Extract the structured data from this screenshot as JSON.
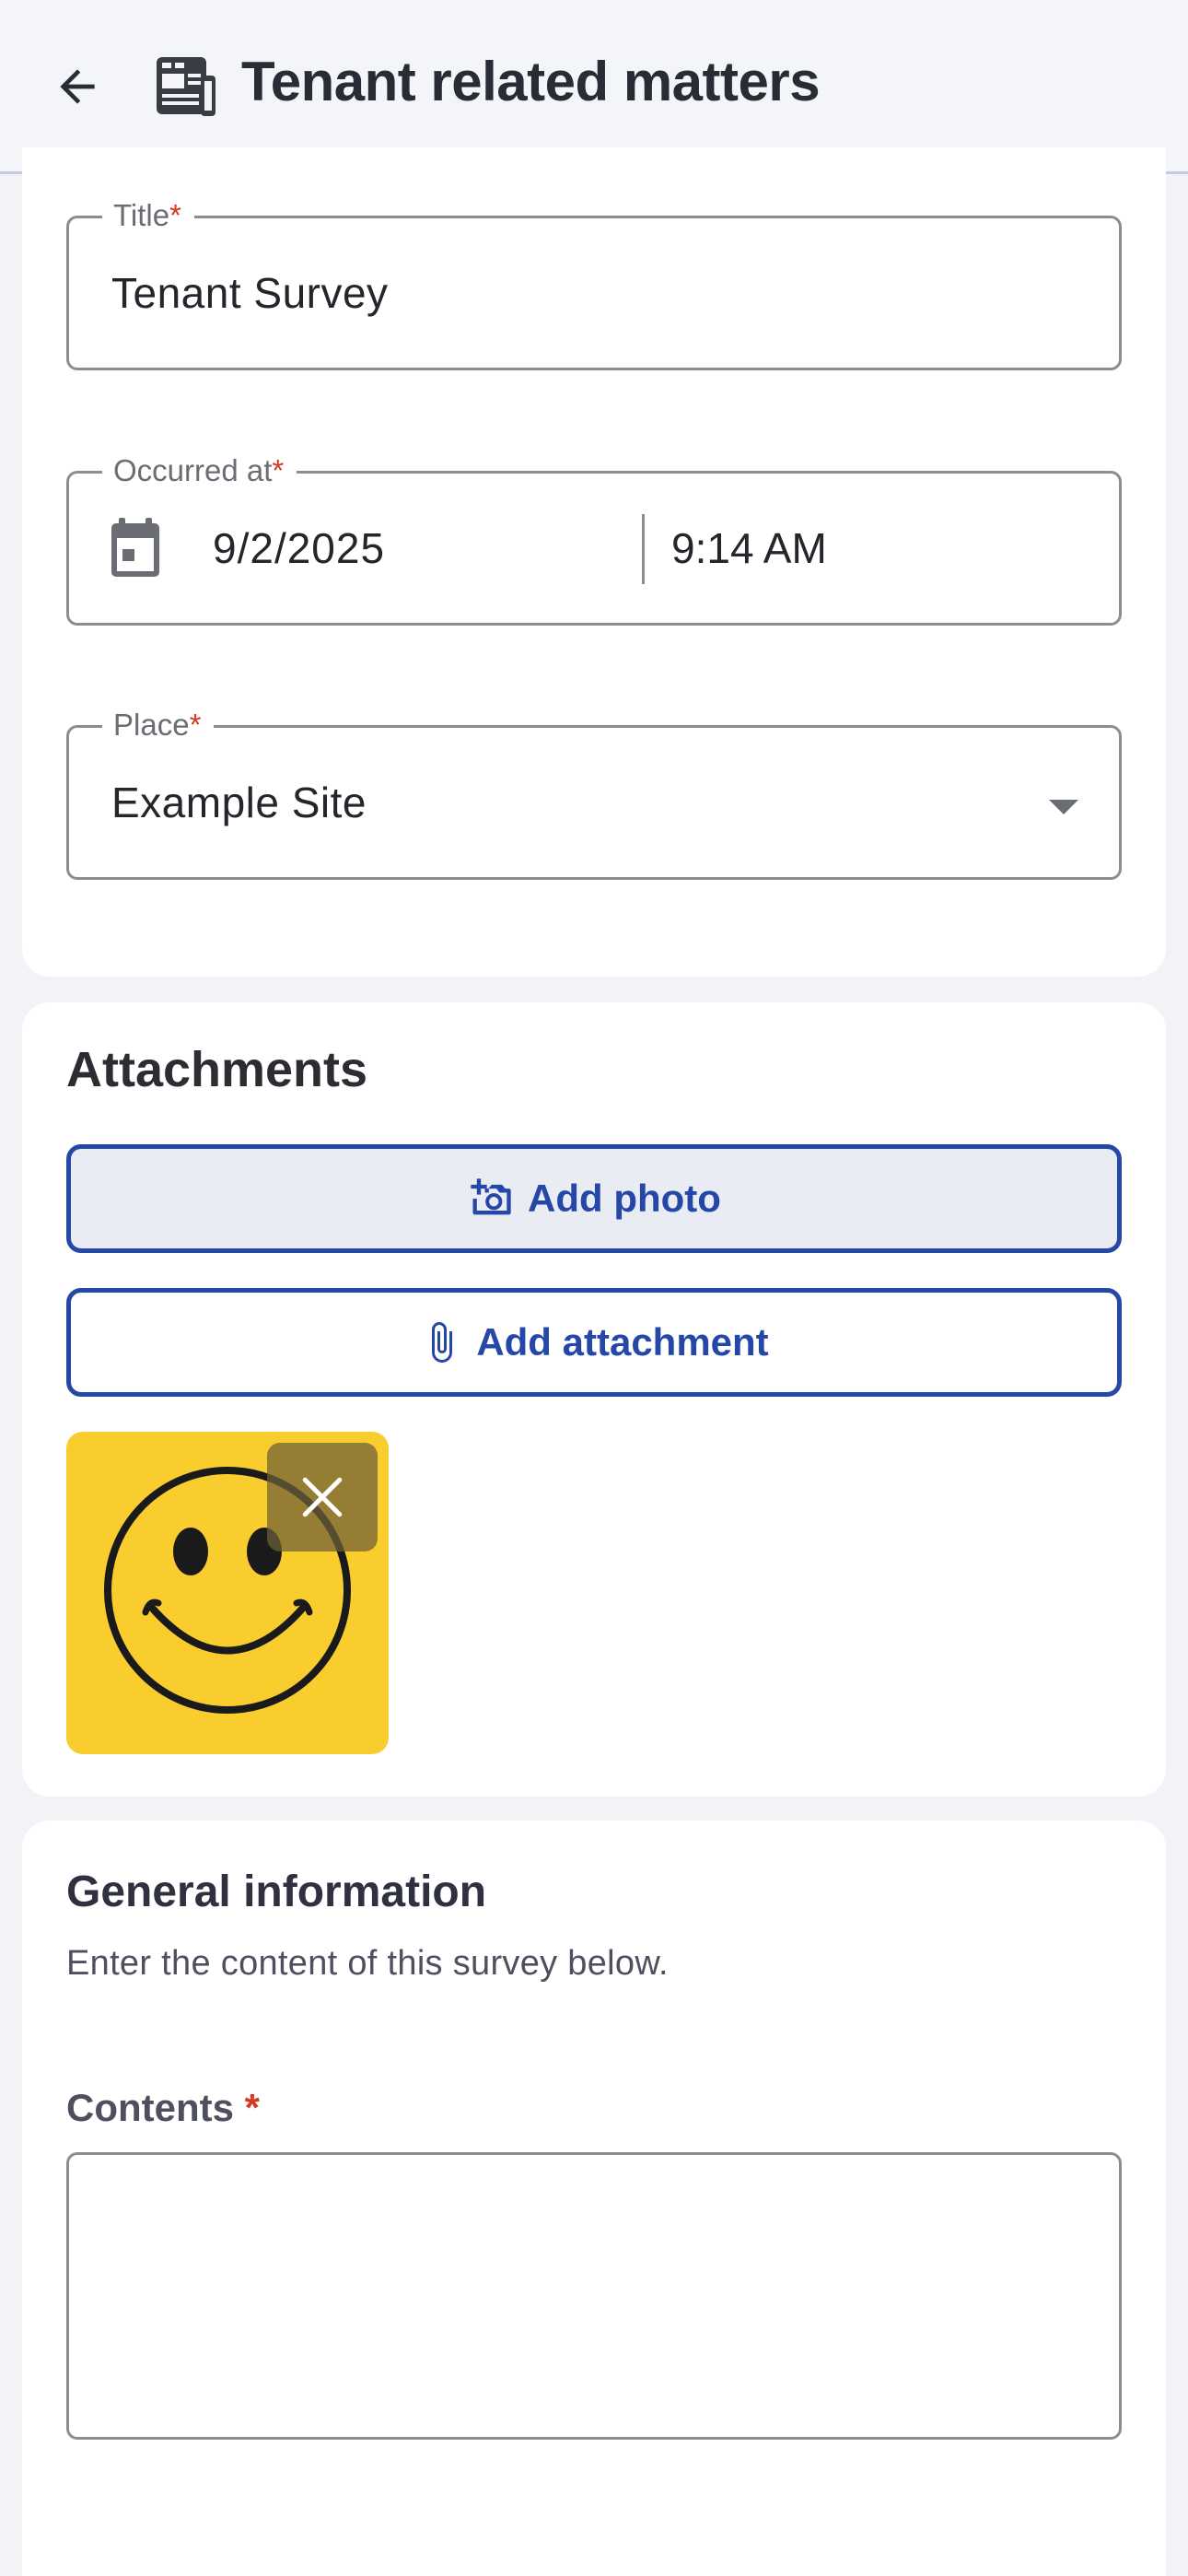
{
  "header": {
    "title": "Tenant related matters",
    "back_icon": "arrow-left-icon",
    "app_icon": "document-icon"
  },
  "form": {
    "title": {
      "label": "Title",
      "required_mark": "*",
      "value": "Tenant Survey"
    },
    "occurred_at": {
      "label": "Occurred at",
      "required_mark": "*",
      "date": "9/2/2025",
      "time": "9:14 AM",
      "icon": "calendar-icon"
    },
    "place": {
      "label": "Place",
      "required_mark": "*",
      "value": "Example Site"
    }
  },
  "attachments": {
    "title": "Attachments",
    "add_photo_label": "Add photo",
    "add_attachment_label": "Add attachment",
    "items": [
      {
        "type": "image",
        "depiction": "smiley-face"
      }
    ]
  },
  "general_info": {
    "title": "General information",
    "description": "Enter the content of this survey below.",
    "contents_label": "Contents",
    "required_mark": "*",
    "contents_value": ""
  },
  "colors": {
    "accent": "#2447a8",
    "required": "#d33a1f",
    "thumb_bg": "#f9cd2e"
  }
}
